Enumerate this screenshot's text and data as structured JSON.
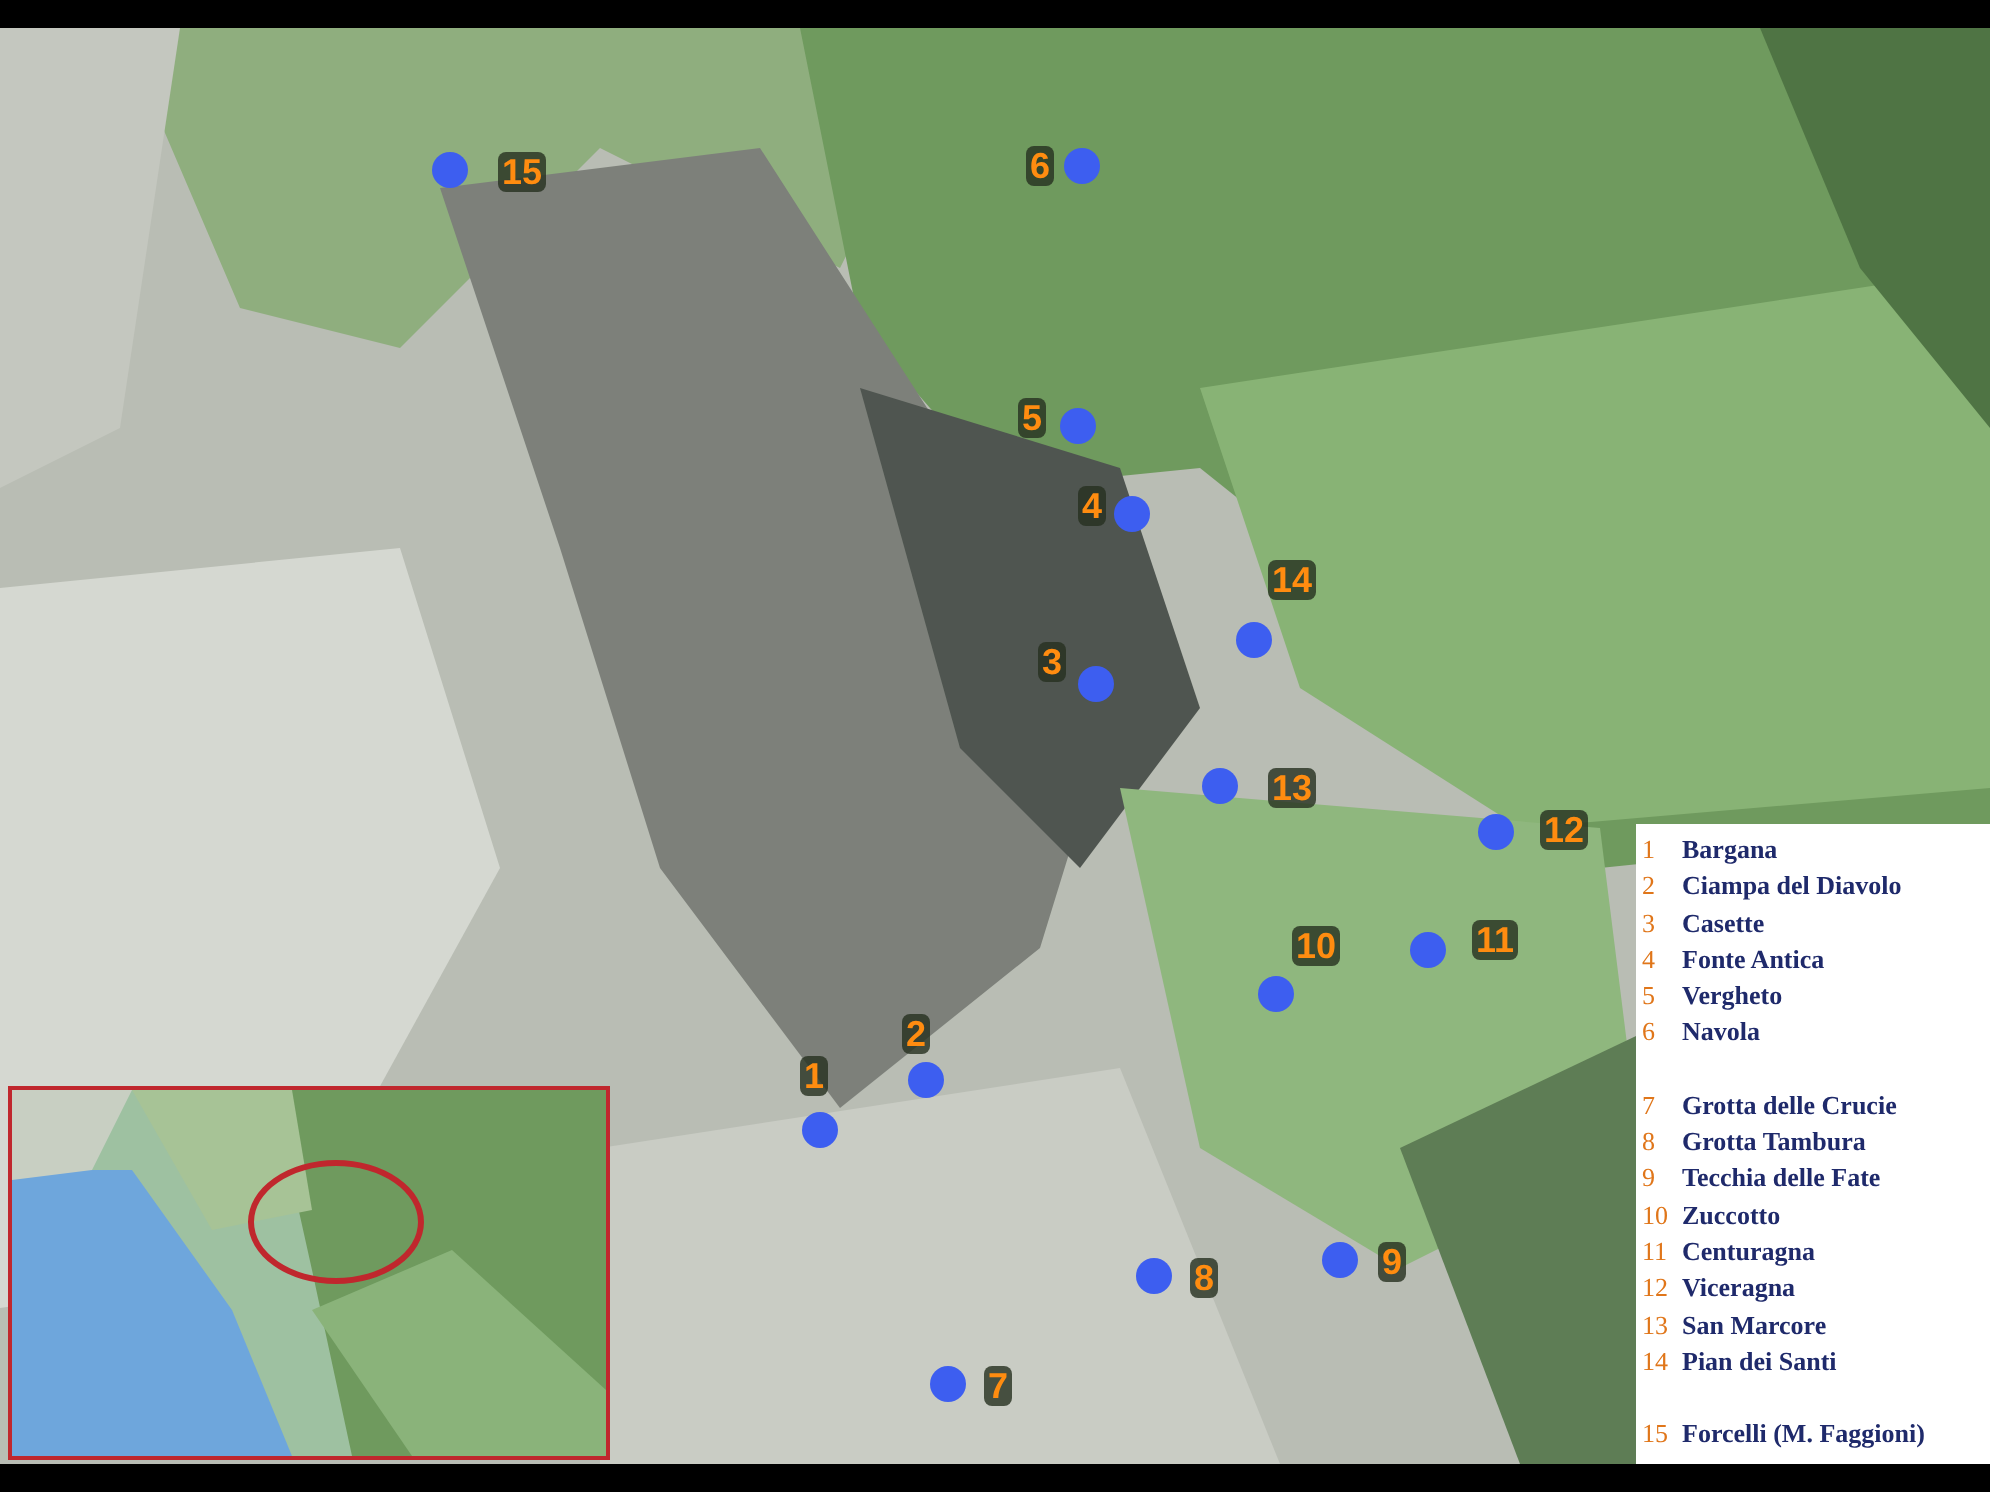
{
  "markers": [
    {
      "label": "1"
    },
    {
      "label": "2"
    },
    {
      "label": "3"
    },
    {
      "label": "4"
    },
    {
      "label": "5"
    },
    {
      "label": "6"
    },
    {
      "label": "7"
    },
    {
      "label": "8"
    },
    {
      "label": "9"
    },
    {
      "label": "10"
    },
    {
      "label": "11"
    },
    {
      "label": "12"
    },
    {
      "label": "13"
    },
    {
      "label": "14"
    },
    {
      "label": "15"
    }
  ],
  "legend": {
    "groups": [
      [
        {
          "number": "1",
          "name": "Bargana"
        },
        {
          "number": "2",
          "name": "Ciampa del Diavolo"
        },
        {
          "number": "3",
          "name": "Casette"
        },
        {
          "number": "4",
          "name": "Fonte Antica"
        },
        {
          "number": "5",
          "name": "Vergheto"
        },
        {
          "number": "6",
          "name": "Navola"
        }
      ],
      [
        {
          "number": "7",
          "name": "Grotta delle Crucie"
        },
        {
          "number": "8",
          "name": "Grotta Tambura"
        },
        {
          "number": "9",
          "name": "Tecchia delle Fate"
        },
        {
          "number": "10",
          "name": "Zuccotto"
        },
        {
          "number": "11",
          "name": "Centuragna"
        },
        {
          "number": "12",
          "name": "Viceragna"
        },
        {
          "number": "13",
          "name": "San Marcore"
        },
        {
          "number": "14",
          "name": "Pian dei Santi"
        }
      ],
      [
        {
          "number": "15",
          "name": "Forcelli (M. Faggioni)"
        }
      ]
    ]
  }
}
